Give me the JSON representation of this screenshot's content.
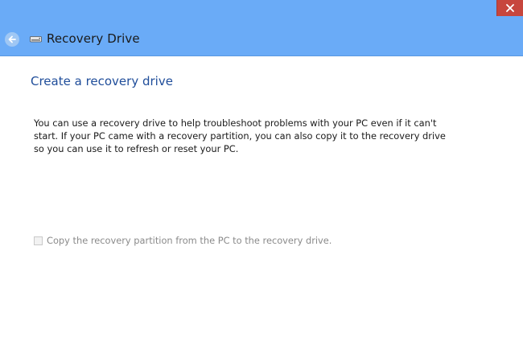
{
  "window": {
    "title": "Recovery Drive",
    "close_glyph": "×"
  },
  "icons": {
    "back": "back-arrow-icon",
    "drive": "drive-icon",
    "close": "close-icon"
  },
  "colors": {
    "titlebar": "#6aabf7",
    "close_button": "#c7463d",
    "heading": "#1f4d9a"
  },
  "main": {
    "heading": "Create a recovery drive",
    "description": "You can use a recovery drive to help troubleshoot problems with your PC even if it can't start. If your PC came with a recovery partition, you can also copy it to the recovery drive so you can use it to refresh or reset your PC.",
    "checkbox": {
      "label": "Copy the recovery partition from the PC to the recovery drive.",
      "checked": false,
      "enabled": false
    }
  }
}
